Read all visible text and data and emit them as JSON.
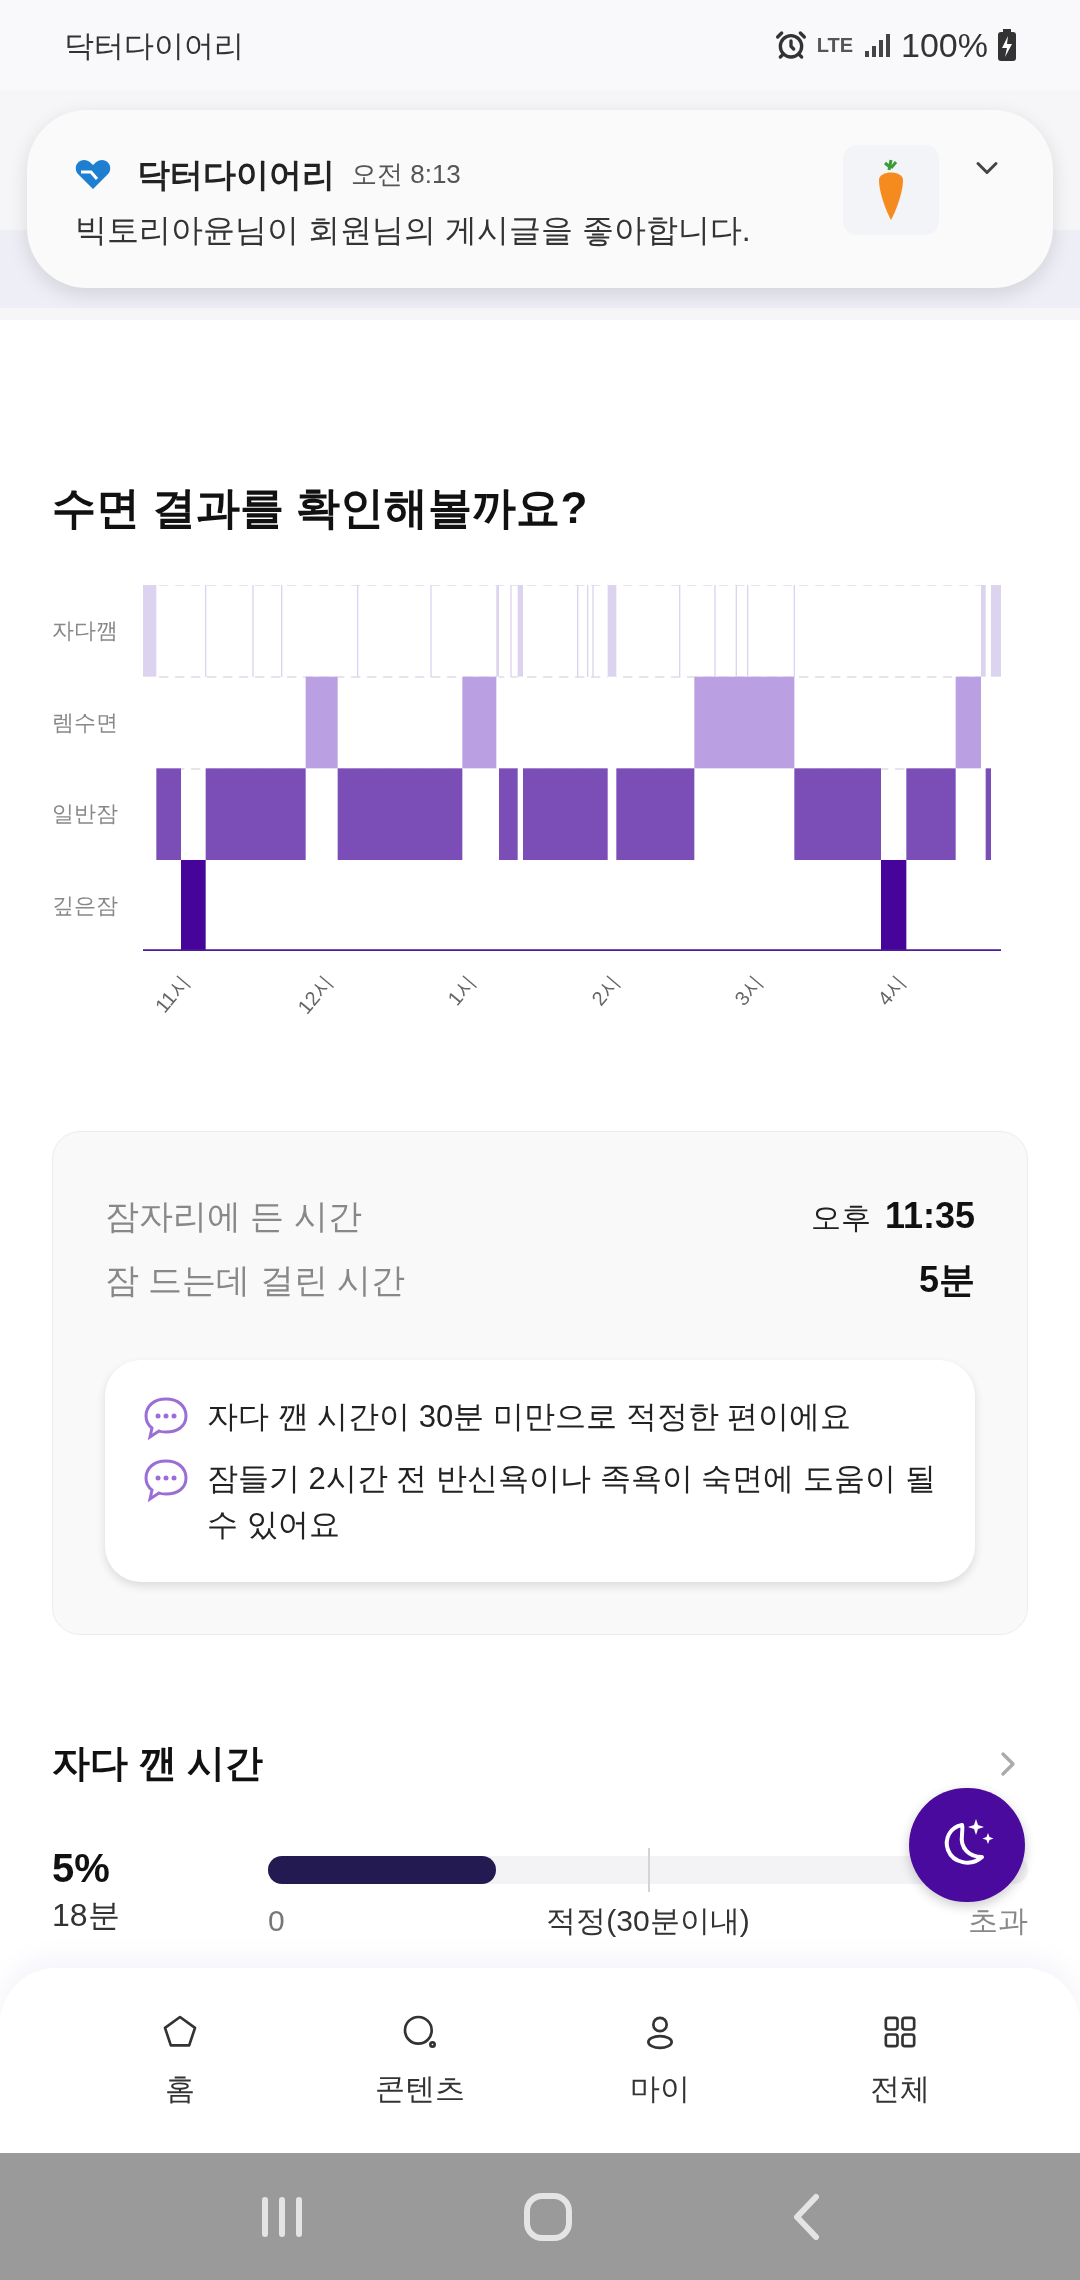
{
  "status_bar": {
    "app_name": "닥터다이어리",
    "network": "LTE",
    "battery": "100%"
  },
  "notification": {
    "app": "닥터다이어리",
    "time": "오전 8:13",
    "message": "빅토리아윤님이 회원님의 게시글을 좋아합니다."
  },
  "sleep_result": {
    "title": "수면 결과를 확인해볼까요?",
    "stage_labels": [
      "자다깸",
      "렘수면",
      "일반잠",
      "깊은잠"
    ],
    "time_labels": [
      "11시",
      "12시",
      "1시",
      "2시",
      "3시",
      "4시"
    ]
  },
  "summary": {
    "rows": [
      {
        "label": "잠자리에 든 시간",
        "prefix": "오후",
        "value": "11:35"
      },
      {
        "label": "잠 드는데 걸린 시간",
        "value": "5분"
      }
    ],
    "tips": [
      "자다 깬 시간이 30분 미만으로 적정한 편이에요",
      "잠들기 2시간 전 반신욕이나 족욕이 숙면에 도움이 될 수 있어요"
    ]
  },
  "awake_time": {
    "title": "자다 깬 시간",
    "percent": "5%",
    "duration": "18분",
    "level": 0.3,
    "scale_labels": [
      "0",
      "적정(30분이내)",
      "초과"
    ]
  },
  "nav": [
    {
      "label": "홈",
      "kind": "home"
    },
    {
      "label": "콘텐츠",
      "kind": "content"
    },
    {
      "label": "마이",
      "kind": "my"
    },
    {
      "label": "전체",
      "kind": "all"
    }
  ]
}
